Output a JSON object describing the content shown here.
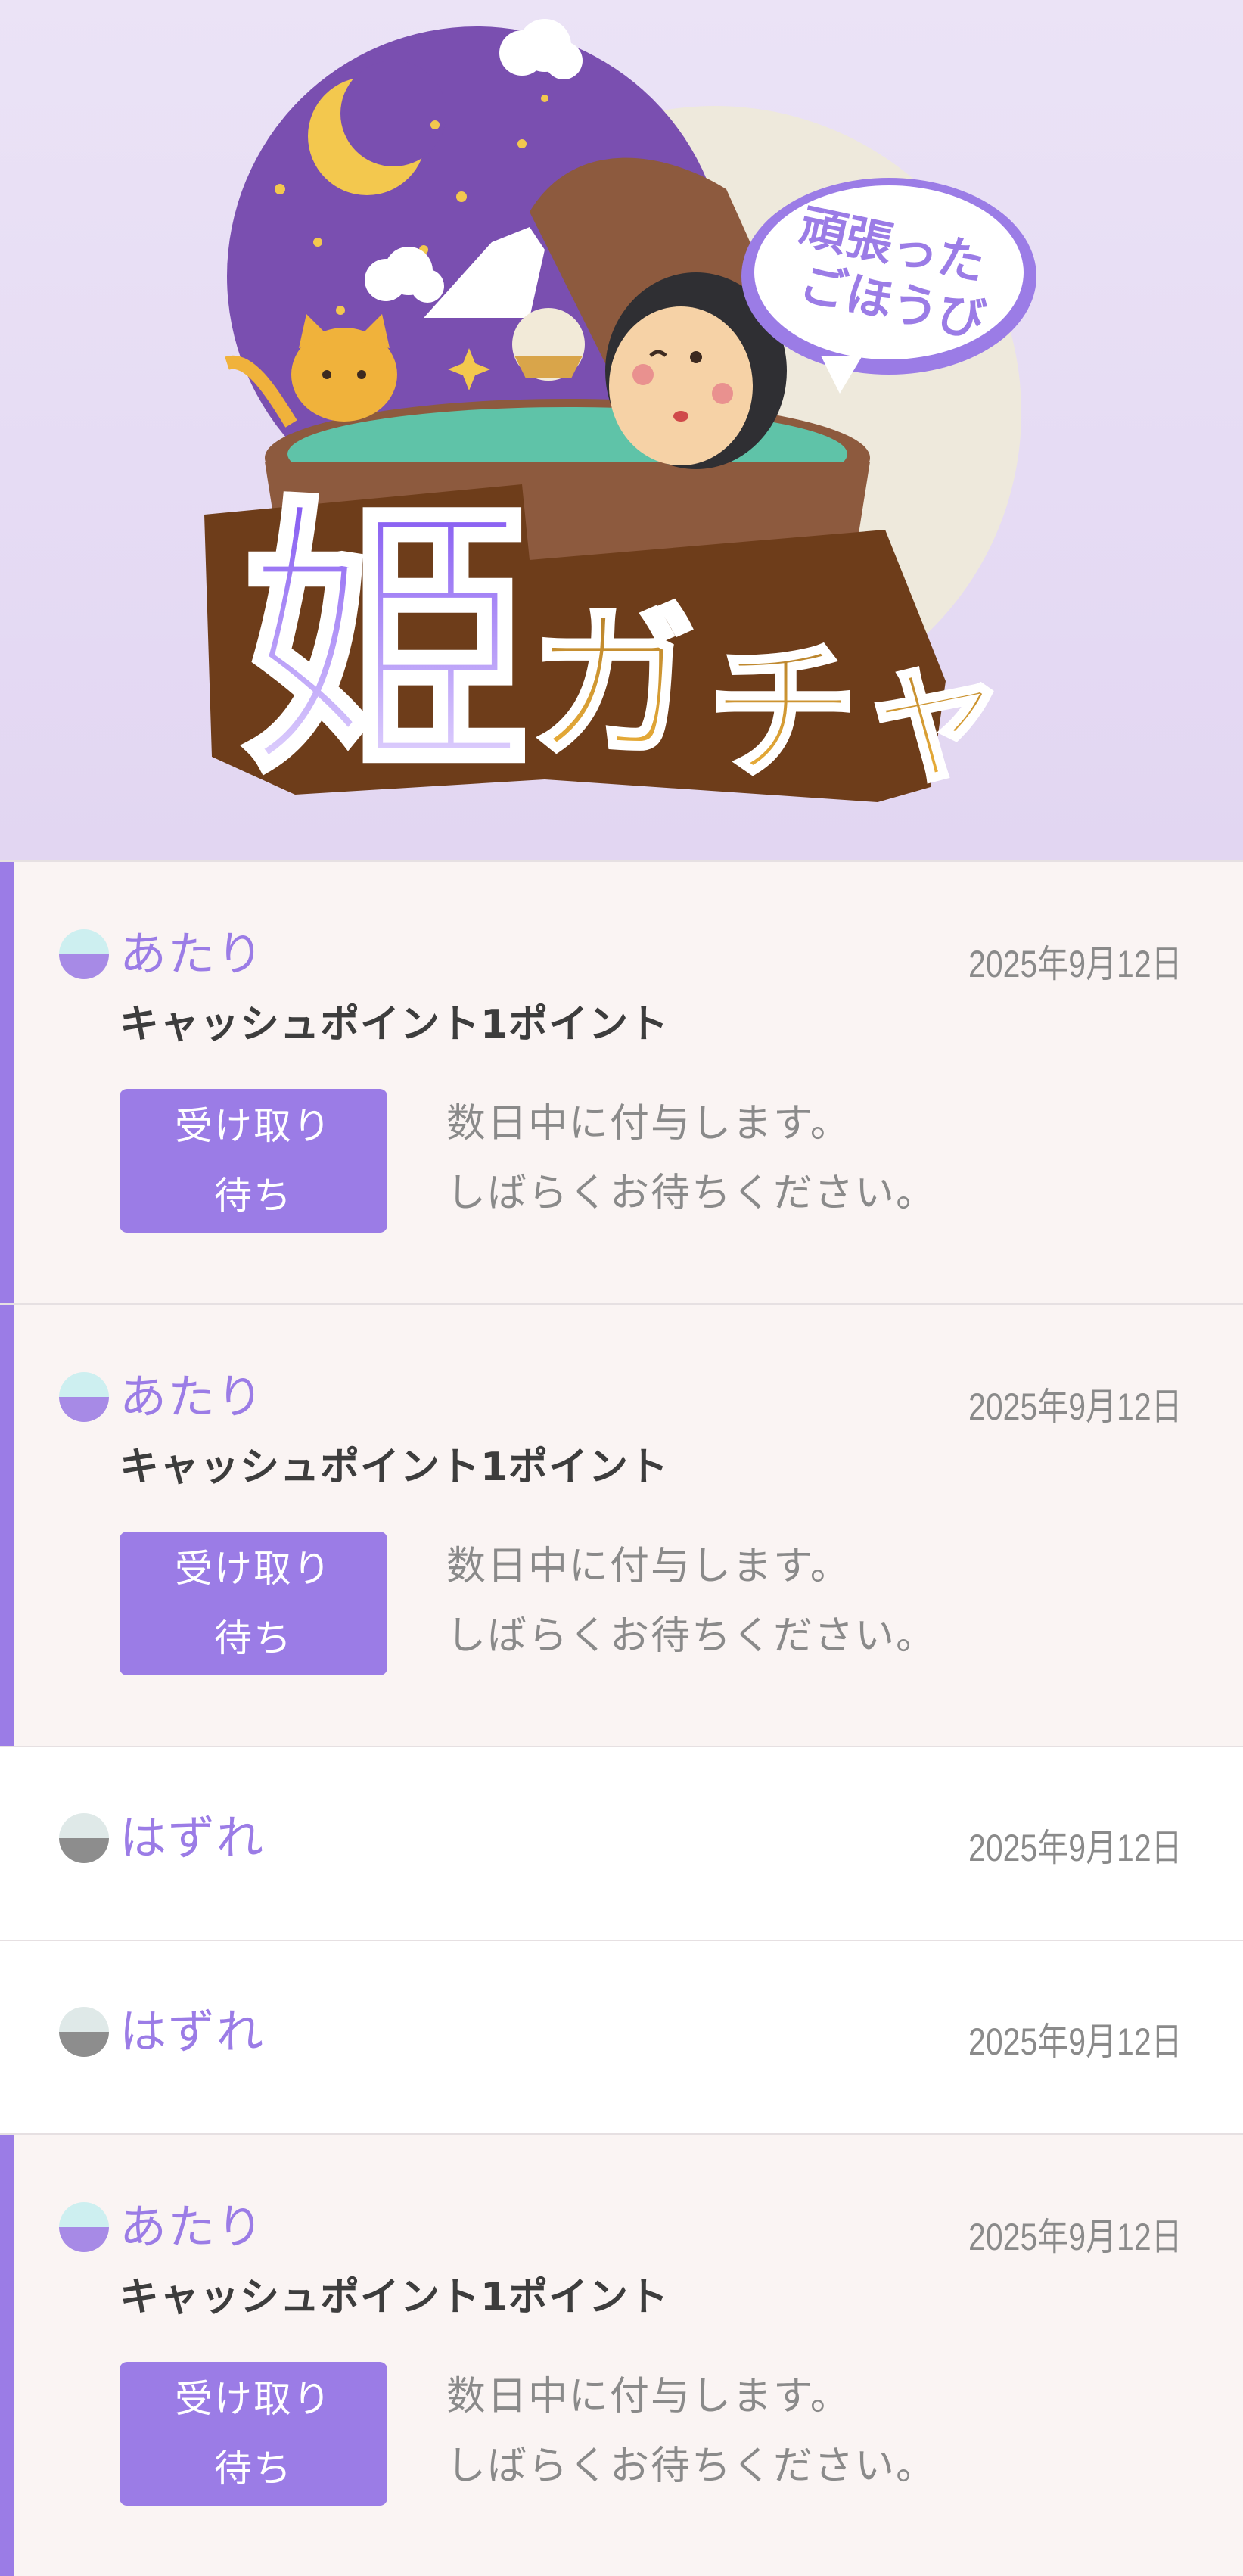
{
  "banner": {
    "title_main": "姫",
    "title_sub_1": "ガ",
    "title_sub_2": "チャ",
    "bubble_line1": "頑張った",
    "bubble_line2": "ごほうび"
  },
  "colors": {
    "accent": "#9b7ce6",
    "win_row_bg": "#faf4f3",
    "lose_row_bg": "#ffffff",
    "date_text": "#8a8a8a",
    "prize_text": "#3d3d3d"
  },
  "results": [
    {
      "status": "あたり",
      "date": "2025年9月12日",
      "prize": "キャッシュポイント1ポイント",
      "button_line1": "受け取り",
      "button_line2": "待ち",
      "note_line1": "数日中に付与します。",
      "note_line2": "しばらくお待ちください。"
    },
    {
      "status": "あたり",
      "date": "2025年9月12日",
      "prize": "キャッシュポイント1ポイント",
      "button_line1": "受け取り",
      "button_line2": "待ち",
      "note_line1": "数日中に付与します。",
      "note_line2": "しばらくお待ちください。"
    },
    {
      "status": "はずれ",
      "date": "2025年9月12日"
    },
    {
      "status": "はずれ",
      "date": "2025年9月12日"
    },
    {
      "status": "あたり",
      "date": "2025年9月12日",
      "prize": "キャッシュポイント1ポイント",
      "button_line1": "受け取り",
      "button_line2": "待ち",
      "note_line1": "数日中に付与します。",
      "note_line2": "しばらくお待ちください。"
    }
  ]
}
